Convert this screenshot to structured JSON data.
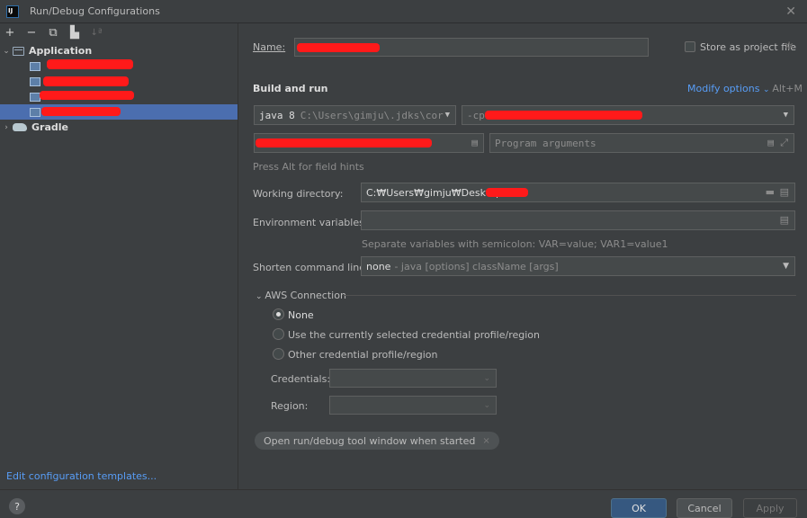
{
  "window": {
    "title": "Run/Debug Configurations",
    "logo": "IJ"
  },
  "toolbar": {
    "add": "+",
    "remove": "−",
    "copy_icon": "copy-icon",
    "folder_icon": "new-folder-icon",
    "sort_icon": "sort-icon",
    "sort": "↓ª"
  },
  "tree": {
    "application_label": "Application",
    "gradle_label": "Gradle"
  },
  "edit_templates": "Edit configuration templates...",
  "form": {
    "name_label": "Name:",
    "store_label": "Store as project file",
    "build_run_title": "Build and run",
    "modify_options": "Modify options",
    "modify_shortcut": "Alt+M",
    "jdk_version": "java 8",
    "jdk_path": "C:\\Users\\gimju\\.jdks\\corre",
    "cp_prefix": "-cp",
    "program_args_placeholder": "Program arguments",
    "field_hint": "Press Alt for field hints",
    "working_dir_label": "Working directory:",
    "working_dir_value": "C:₩Users₩gimju₩Desktop₩",
    "env_vars_label": "Environment variables:",
    "env_hint": "Separate variables with semicolon: VAR=value; VAR1=value1",
    "shorten_label": "Shorten command line:",
    "shorten_value": "none",
    "shorten_hint": "- java [options] className [args]",
    "aws_title": "AWS Connection",
    "aws_options": [
      {
        "label": "None",
        "selected": true
      },
      {
        "label": "Use the currently selected credential profile/region",
        "selected": false
      },
      {
        "label": "Other credential profile/region",
        "selected": false
      }
    ],
    "credentials_label": "Credentials:",
    "region_label": "Region:",
    "chip_label": "Open run/debug tool window when started",
    "chip_close": "×"
  },
  "buttons": {
    "help": "?",
    "ok": "OK",
    "cancel": "Cancel",
    "apply": "Apply"
  },
  "colors": {
    "background": "#3c3f41",
    "selection": "#4b6eaf",
    "link": "#589df6",
    "redaction": "#ff1a1a"
  }
}
